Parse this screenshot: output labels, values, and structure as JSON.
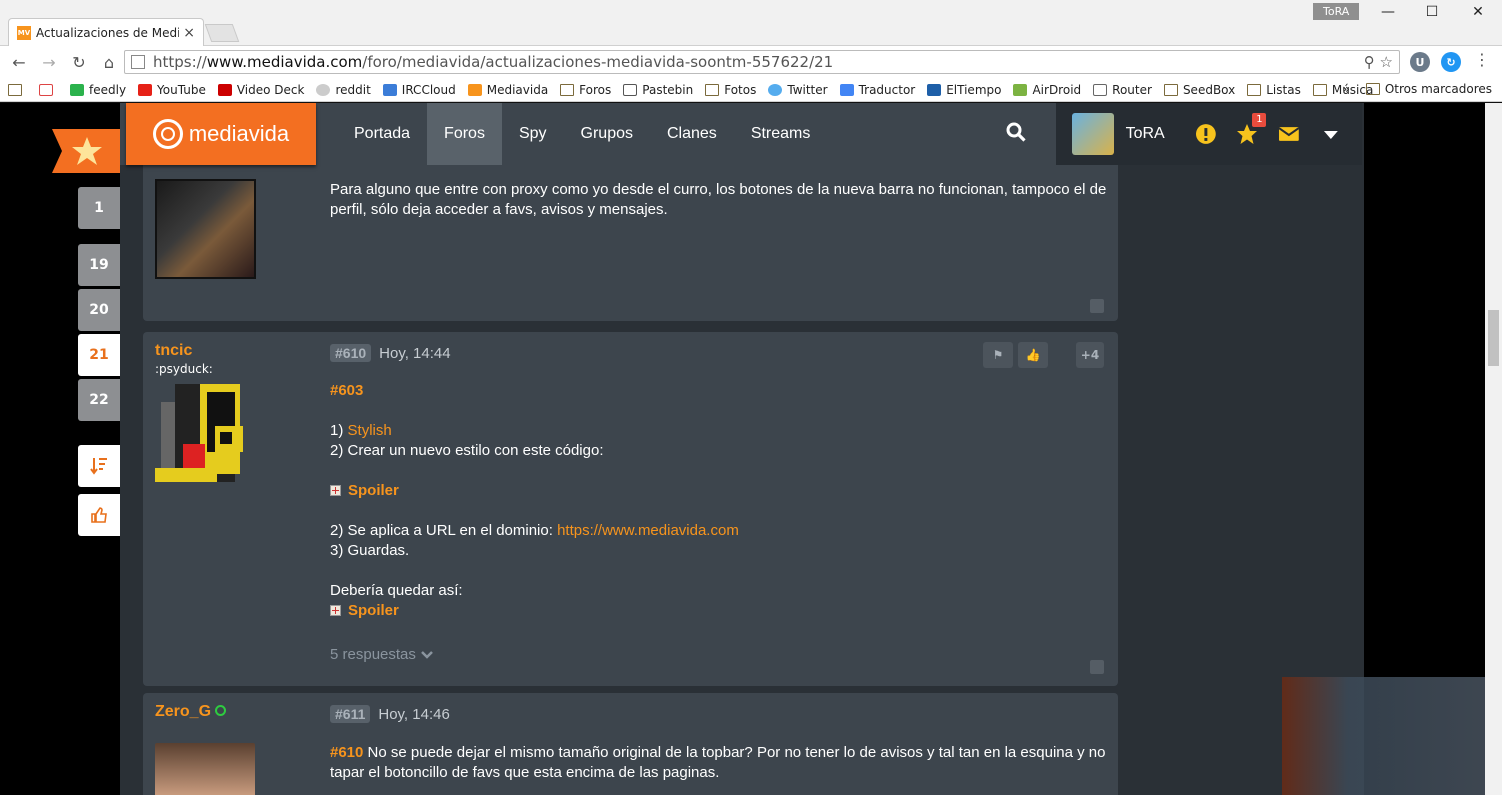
{
  "browser": {
    "tab_title": "Actualizaciones de Media",
    "tab_favicon": "MV",
    "profile_name": "ToRA",
    "url_scheme": "https://",
    "url_host": "www.mediavida.com",
    "url_path": "/foro/mediavida/actualizaciones-mediavida-soontm-557622/21",
    "bookmarks": [
      "feedly",
      "YouTube",
      "Video Deck",
      "reddit",
      "IRCCloud",
      "Mediavida",
      "Foros",
      "Pastebin",
      "Fotos",
      "Twitter",
      "Traductor",
      "ElTiempo",
      "AirDroid",
      "Router",
      "SeedBox",
      "Listas",
      "Música"
    ],
    "bookmarks_more": "»",
    "other_bookmarks": "Otros marcadores"
  },
  "site": {
    "logo_text": "mediavida",
    "nav": [
      "Portada",
      "Foros",
      "Spy",
      "Grupos",
      "Clanes",
      "Streams"
    ],
    "active_nav": "Foros",
    "username": "ToRA",
    "fav_badge": "1",
    "accent_color": "#f7941d"
  },
  "rail": {
    "pages": [
      "1",
      "19",
      "20",
      "21",
      "22"
    ],
    "active_page": "21"
  },
  "posts": [
    {
      "text": "Para alguno que entre con proxy como yo desde el curro, los botones de la nueva barra no funcionan, tampoco el de perfil, sólo deja acceder a favs, avisos y mensajes."
    },
    {
      "user": "tncic",
      "user_tag": ":psyduck:",
      "number": "#610",
      "time": "Hoy, 14:44",
      "votes": "+4",
      "quote_ref": "#603",
      "line1_prefix": "1) ",
      "line1_link": "Stylish",
      "line2": "2) Crear un nuevo estilo con este código:",
      "spoiler1": "Spoiler",
      "line3_prefix": "2) Se aplica a URL en el dominio: ",
      "line3_link": "https://www.mediavida.com",
      "line4": "3) Guardas.",
      "line5": "Debería quedar así:",
      "spoiler2": "Spoiler",
      "replies": "5 respuestas"
    },
    {
      "user": "Zero_G",
      "number": "#611",
      "time": "Hoy, 14:46",
      "quote_ref": "#610",
      "text": "No se puede dejar el mismo tamaño original de la topbar? Por no tener lo de avisos y tal tan en la esquina y no tapar el botoncillo de favs que esta encima de las paginas."
    }
  ]
}
